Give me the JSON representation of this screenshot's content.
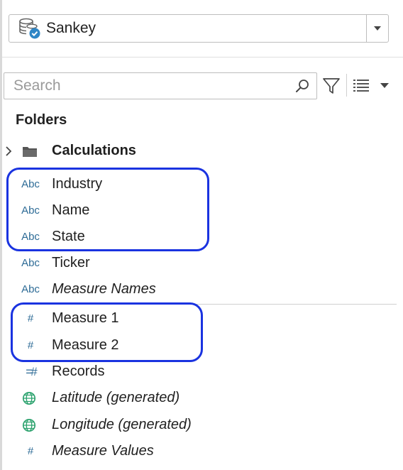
{
  "datasource": {
    "name": "Sankey",
    "icon": "database-check-icon"
  },
  "search": {
    "placeholder": "Search",
    "value": ""
  },
  "toolbar": {
    "filter_icon": "funnel-icon",
    "view_icon": "list-view-icon",
    "menu_icon": "caret-down-icon"
  },
  "folders": {
    "title": "Folders",
    "calculations_label": "Calculations"
  },
  "dimensions": [
    {
      "type": "Abc",
      "label": "Industry",
      "italic": false
    },
    {
      "type": "Abc",
      "label": "Name",
      "italic": false
    },
    {
      "type": "Abc",
      "label": "State",
      "italic": false
    },
    {
      "type": "Abc",
      "label": "Ticker",
      "italic": false
    },
    {
      "type": "Abc",
      "label": "Measure Names",
      "italic": true
    }
  ],
  "measures": [
    {
      "type": "#",
      "label": "Measure 1",
      "italic": false
    },
    {
      "type": "#",
      "label": "Measure 2",
      "italic": false
    },
    {
      "type": "=#",
      "label": "Records",
      "italic": false
    },
    {
      "type": "globe",
      "label": "Latitude (generated)",
      "italic": true
    },
    {
      "type": "globe",
      "label": "Longitude (generated)",
      "italic": true
    },
    {
      "type": "#",
      "label": "Measure Values",
      "italic": true
    }
  ],
  "colors": {
    "dimension_icon": "#2d6b96",
    "measure_icon": "#2ea36f",
    "highlight": "#1a33e0"
  }
}
